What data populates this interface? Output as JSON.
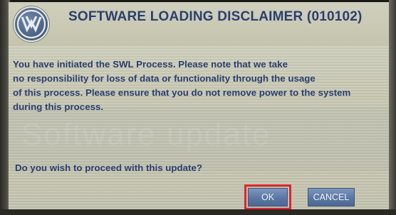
{
  "dialog": {
    "title": "SOFTWARE LOADING DISCLAIMER (010102)",
    "message_lines": [
      "You have initiated the SWL Process. Please note that we take",
      "no responsibility for loss of data or functionality through the usage",
      "of this process. Please ensure that you do not remove power to the system",
      "during this process."
    ],
    "watermark": "Software update",
    "question": "Do you wish to proceed with this update?",
    "ok_label": "OK",
    "cancel_label": "CANCEL",
    "logo_icon": "vw-logo-icon"
  },
  "colors": {
    "text": "#2b3f6e",
    "screen_bg": "#c9c9b6",
    "button": "#5b76a2",
    "highlight": "#e0262b"
  }
}
